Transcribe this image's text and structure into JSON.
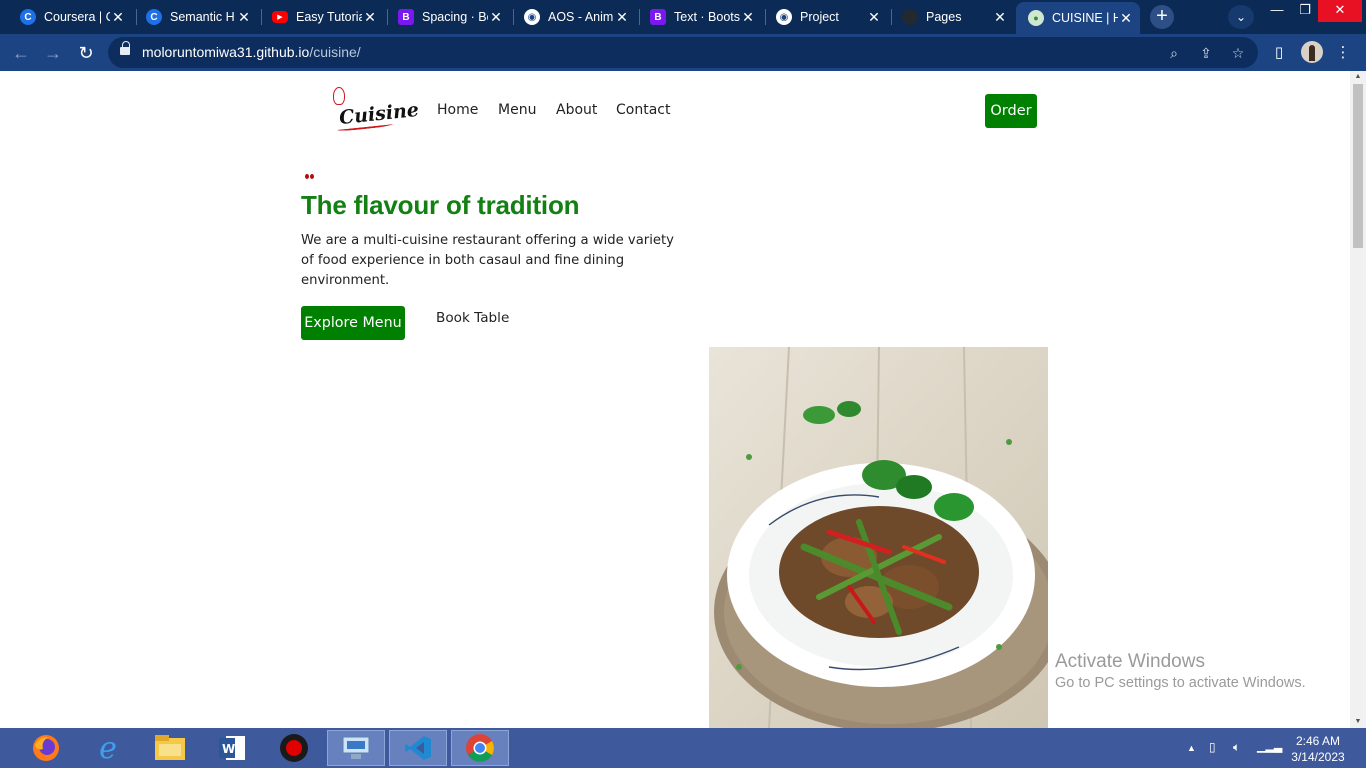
{
  "browser": {
    "tabs": [
      {
        "label": "Coursera | C",
        "favicon": "coursera-icon",
        "favicon_color": "#1f6fe6",
        "active": false
      },
      {
        "label": "Semantic H",
        "favicon": "coursera-icon",
        "favicon_color": "#1f6fe6",
        "active": false
      },
      {
        "label": "Easy Tutoria",
        "favicon": "youtube-icon",
        "favicon_color": "#ff0000",
        "active": false
      },
      {
        "label": "Spacing · Bo",
        "favicon": "bootstrap-icon",
        "favicon_color": "#7a18f0",
        "active": false
      },
      {
        "label": "AOS - Anim",
        "favicon": "globe-icon",
        "favicon_color": "#ffffff",
        "active": false
      },
      {
        "label": "Text · Boots",
        "favicon": "bootstrap-icon",
        "favicon_color": "#7a18f0",
        "active": false
      },
      {
        "label": "Project",
        "favicon": "globe-icon",
        "favicon_color": "#ffffff",
        "active": false
      },
      {
        "label": "Pages",
        "favicon": "github-icon",
        "favicon_color": "#24292f",
        "active": false
      },
      {
        "label": "CUISINE | H",
        "favicon": "cuisine-icon",
        "favicon_color": "#2e8b3a",
        "active": true
      }
    ],
    "url_domain": "moloruntomiwa31.github.io",
    "url_path": "/cuisine/",
    "chrome_color": "#0b2a55",
    "toolbar_color": "#1c4482"
  },
  "site": {
    "logo_text": "Cuisine",
    "nav": [
      "Home",
      "Menu",
      "About",
      "Contact"
    ],
    "order_label": "Order",
    "hero_title": "The flavour of tradition",
    "hero_description": "We are a multi-cuisine restaurant offering a wide variety of food experience in both casaul and fine dining environment.",
    "explore_label": "Explore Menu",
    "book_label": "Book Table",
    "accent_color": "#008000"
  },
  "watermark": {
    "line1": "Activate Windows",
    "line2": "Go to PC settings to activate Windows."
  },
  "taskbar": {
    "apps": [
      "firefox-icon",
      "internet-explorer-icon",
      "file-explorer-icon",
      "word-icon",
      "recorder-icon",
      "remote-desktop-icon",
      "vscode-icon",
      "chrome-icon"
    ],
    "time": "2:46 AM",
    "date": "3/14/2023"
  }
}
